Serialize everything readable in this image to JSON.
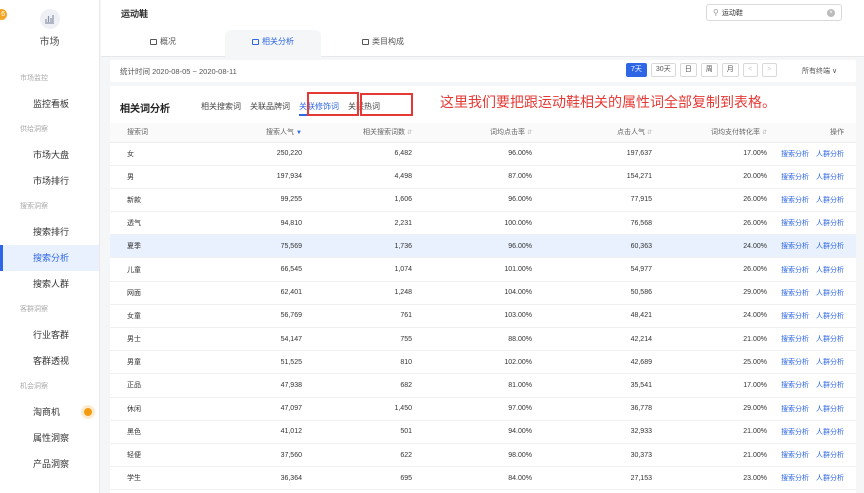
{
  "sidebar": {
    "logo_label": "市场",
    "corner_badge": "6",
    "groups": [
      {
        "title": "市场监控",
        "items": [
          {
            "label": "监控看板"
          }
        ]
      },
      {
        "title": "供给洞察",
        "items": [
          {
            "label": "市场大盘"
          },
          {
            "label": "市场排行"
          }
        ]
      },
      {
        "title": "搜索洞察",
        "items": [
          {
            "label": "搜索排行"
          },
          {
            "label": "搜索分析",
            "active": true
          },
          {
            "label": "搜索人群"
          }
        ]
      },
      {
        "title": "客群洞察",
        "items": [
          {
            "label": "行业客群"
          },
          {
            "label": "客群透视"
          }
        ]
      },
      {
        "title": "机会洞察",
        "items": [
          {
            "label": "淘商机",
            "dot": true
          },
          {
            "label": "属性洞察"
          },
          {
            "label": "产品洞察"
          }
        ]
      }
    ]
  },
  "header": {
    "title": "运动鞋",
    "search_value": "运动鞋",
    "tabs": [
      {
        "label": "概况"
      },
      {
        "label": "相关分析",
        "active": true
      },
      {
        "label": "类目构成"
      }
    ]
  },
  "datebar": {
    "period": "统计时间 2020-08-05 ~ 2020-08-11",
    "buttons": [
      "7天",
      "30天",
      "日",
      "周",
      "月",
      "<",
      ">"
    ],
    "device": "所有终端 ∨"
  },
  "panel": {
    "title": "相关词分析",
    "subtabs": [
      "相关搜索词",
      "关联品牌词",
      "关联修饰词",
      "关联热词"
    ],
    "active_subtab": 2,
    "note": "这里我们要把跟运动鞋相关的属性词全部复制到表格。"
  },
  "table": {
    "headers": [
      "搜索词",
      "搜索人气",
      "相关搜索词数",
      "词均点击率",
      "点击人气",
      "词均支付转化率",
      "操作"
    ],
    "actions": [
      "搜索分析",
      "人群分析"
    ],
    "highlight_row": 4,
    "rows": [
      [
        "女",
        "250,220",
        "6,482",
        "96.00%",
        "197,637",
        "17.00%"
      ],
      [
        "男",
        "197,934",
        "4,498",
        "87.00%",
        "154,271",
        "20.00%"
      ],
      [
        "新款",
        "99,255",
        "1,606",
        "96.00%",
        "77,915",
        "26.00%"
      ],
      [
        "透气",
        "94,810",
        "2,231",
        "100.00%",
        "76,568",
        "26.00%"
      ],
      [
        "夏季",
        "75,569",
        "1,736",
        "96.00%",
        "60,363",
        "24.00%"
      ],
      [
        "儿童",
        "66,545",
        "1,074",
        "101.00%",
        "54,977",
        "26.00%"
      ],
      [
        "网面",
        "62,401",
        "1,248",
        "104.00%",
        "50,586",
        "29.00%"
      ],
      [
        "女童",
        "56,769",
        "761",
        "103.00%",
        "48,421",
        "24.00%"
      ],
      [
        "男士",
        "54,147",
        "755",
        "88.00%",
        "42,214",
        "21.00%"
      ],
      [
        "男童",
        "51,525",
        "810",
        "102.00%",
        "42,689",
        "25.00%"
      ],
      [
        "正品",
        "47,938",
        "682",
        "81.00%",
        "35,541",
        "17.00%"
      ],
      [
        "休闲",
        "47,097",
        "1,450",
        "97.00%",
        "36,778",
        "29.00%"
      ],
      [
        "黑色",
        "41,012",
        "501",
        "94.00%",
        "32,933",
        "21.00%"
      ],
      [
        "轻便",
        "37,560",
        "622",
        "98.00%",
        "30,373",
        "21.00%"
      ],
      [
        "学生",
        "36,364",
        "695",
        "84.00%",
        "27,153",
        "23.00%"
      ]
    ]
  },
  "colors": {
    "accent": "#2e66e6",
    "annotation": "#e53935",
    "highlight_row": "#e9f1fe"
  }
}
